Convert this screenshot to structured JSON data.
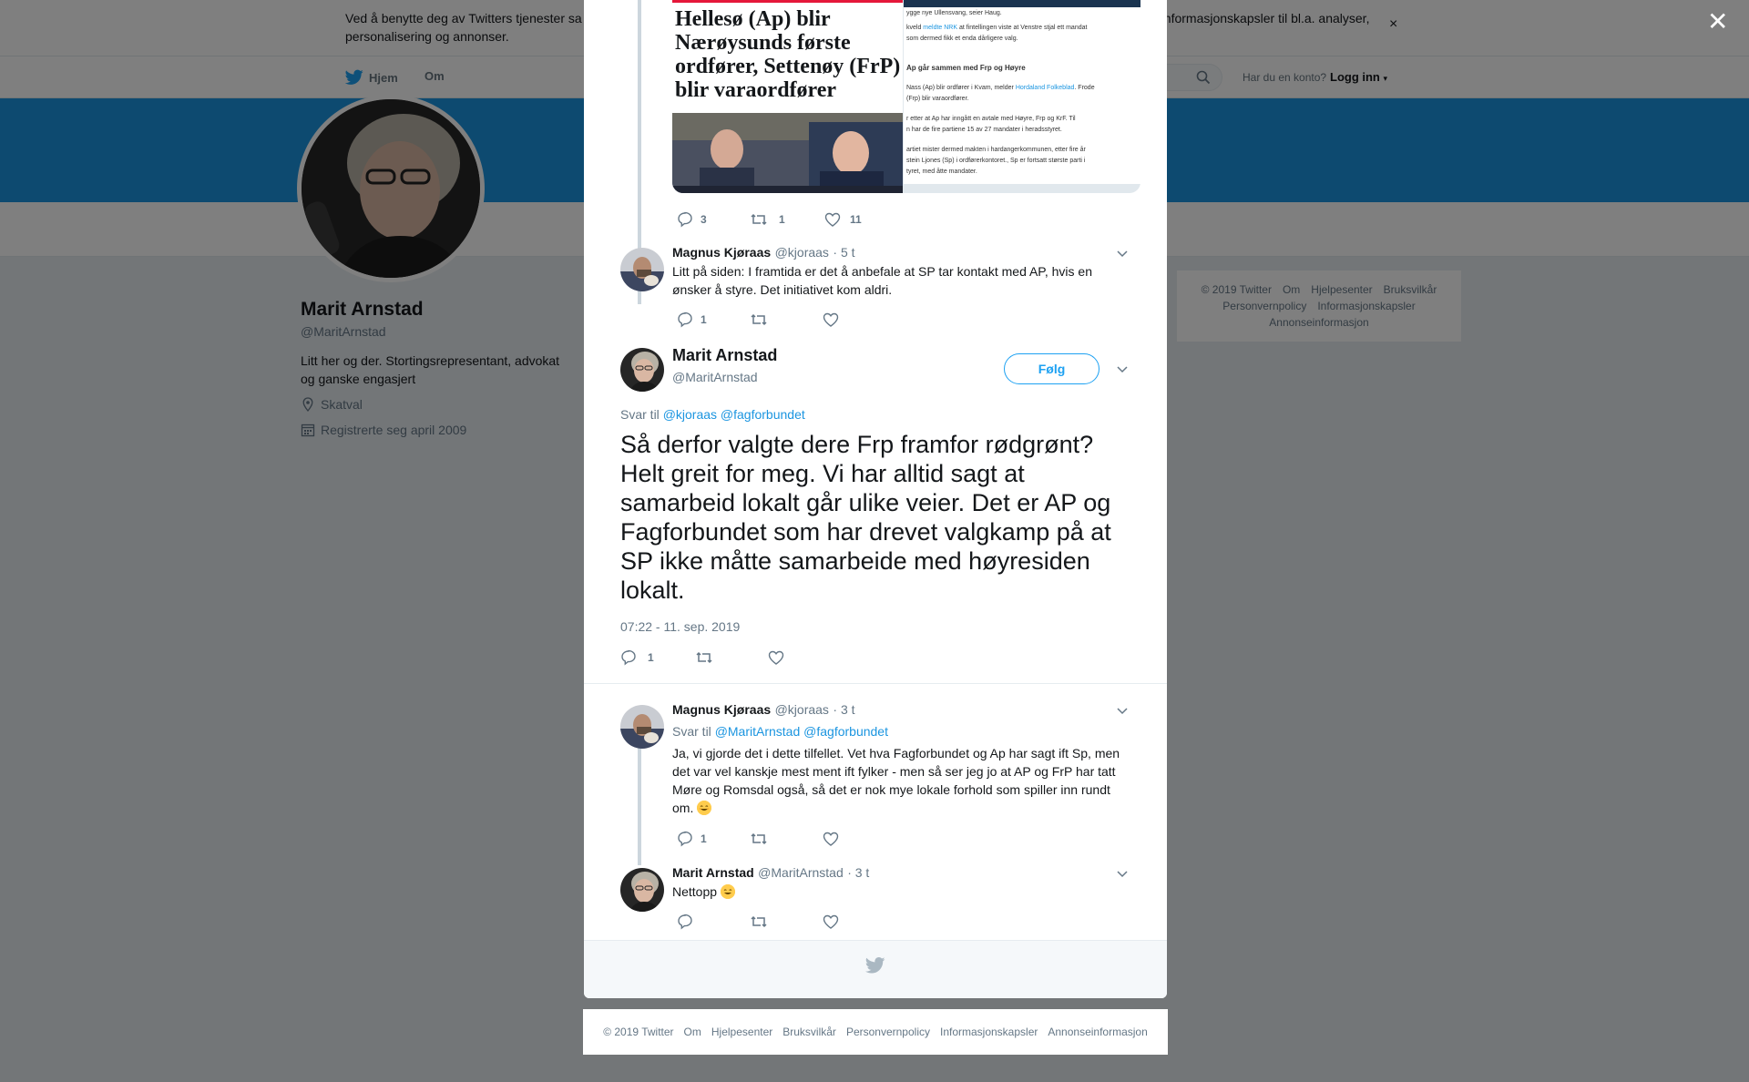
{
  "cookie_bar": {
    "text_start": "Ved å benytte deg av Twitters tjenester sa",
    "text_end": "informasjonskapsler til bl.a. analyser,",
    "text_line2": "personalisering og annonser."
  },
  "nav": {
    "home": "Hjem",
    "about": "Om",
    "login_question": "Har du en konto?",
    "login": "Logg inn"
  },
  "profile": {
    "name": "Marit Arnstad",
    "handle": "@MaritArnstad",
    "bio": "Litt her og der. Stortingsrepresentant, advokat og ganske engasjert",
    "location": "Skatval",
    "joined": "Registrerte seg april 2009"
  },
  "side_footer": {
    "line1": [
      "© 2019 Twitter",
      "Om",
      "Hjelpesenter",
      "Bruksvilkår"
    ],
    "line2": [
      "Personvernpolicy",
      "Informasjonskapsler"
    ],
    "line3": [
      "Annonseinformasjon"
    ]
  },
  "news_card": {
    "headline": "Hellesø (Ap) blir Nærøysunds første ordfører, Settenøy (FrP) blir varaordfører",
    "article_lines": [
      {
        "text": "ygge nye Ullensvang, seier Haug.",
        "bold": false
      },
      {
        "text": "kveld ",
        "link": "meldte NRK",
        "rest": " at fintellingen viste at Venstre stjal ett mandat",
        "bold": false
      },
      {
        "text": "som dermed fikk et enda dårligere valg.",
        "bold": false
      },
      {
        "text": "Ap går sammen med Frp og Høyre",
        "bold": true
      },
      {
        "text": "Nass (Ap) blir ordfører i Kvam, melder ",
        "link": "Hordaland Folkeblad",
        "rest": ". Frode",
        "bold": false
      },
      {
        "text": "(Frp) blir varaordfører.",
        "bold": false
      },
      {
        "text": "r etter at Ap har inngått en avtale med Høyre, Frp og KrF. Til",
        "bold": false
      },
      {
        "text": "n har de fire partiene 15 av 27 mandater i heradsstyret.",
        "bold": false
      },
      {
        "text": "artiet mister dermed makten i hardangerkommunen, etter fire år",
        "bold": false
      },
      {
        "text": "stein Ljones (Sp) i ordførerkontoret., Sp er fortsatt største parti i",
        "bold": false
      },
      {
        "text": "tyret, med åtte mandater.",
        "bold": false
      }
    ]
  },
  "first_tweet_actions": {
    "replies": "3",
    "retweets": "1",
    "likes": "11"
  },
  "tweet2": {
    "name": "Magnus Kjøraas",
    "handle": "@kjoraas",
    "time": "· 5 t",
    "text": "Litt på siden: I framtida er det å anbefale at SP tar kontakt med AP, hvis en ønsker å styre. Det initiativet kom aldri.",
    "replies": "1"
  },
  "main_tweet": {
    "name": "Marit Arnstad",
    "handle": "@MaritArnstad",
    "follow": "Følg",
    "reply_prefix": "Svar til",
    "reply_users": "@kjoraas @fagforbundet",
    "text": "Så derfor valgte dere Frp framfor rødgrønt? Helt greit for meg. Vi har alltid sagt at samarbeid lokalt går ulike veier. Det er AP og Fagforbundet som har drevet valgkamp på at SP ikke måtte samarbeide med høyresiden lokalt.",
    "date": "07:22 - 11. sep. 2019",
    "replies": "1"
  },
  "tweet4": {
    "name": "Magnus Kjøraas",
    "handle": "@kjoraas",
    "time": "· 3 t",
    "reply_prefix": "Svar til",
    "reply_users": "@MaritArnstad @fagforbundet",
    "text": "Ja, vi gjorde det i dette tilfellet. Vet hva Fagforbundet og Ap har sagt ift Sp, men det var vel kanskje mest ment ift fylker - men så ser jeg jo at AP og FrP har tatt Møre og Romsdal også, så det er nok mye lokale forhold som spiller inn rundt om.",
    "replies": "1"
  },
  "tweet5": {
    "name": "Marit Arnstad",
    "handle": "@MaritArnstad",
    "time": "· 3 t",
    "text": "Nettopp"
  },
  "bottom_footer": [
    "© 2019 Twitter",
    "Om",
    "Hjelpesenter",
    "Bruksvilkår",
    "Personvernpolicy",
    "Informasjonskapsler",
    "Annonseinformasjon"
  ],
  "colors": {
    "banner": "#1b95e0",
    "link": "#1b95e0",
    "follow": "#1da1f2",
    "overlay": "rgba(0,0,0,0.5)"
  },
  "icons": [
    "twitter-bird-icon",
    "search-icon",
    "close-icon",
    "location-icon",
    "calendar-icon",
    "reply-icon",
    "retweet-icon",
    "like-icon",
    "chevron-down-icon",
    "smiling-face-emoji"
  ]
}
